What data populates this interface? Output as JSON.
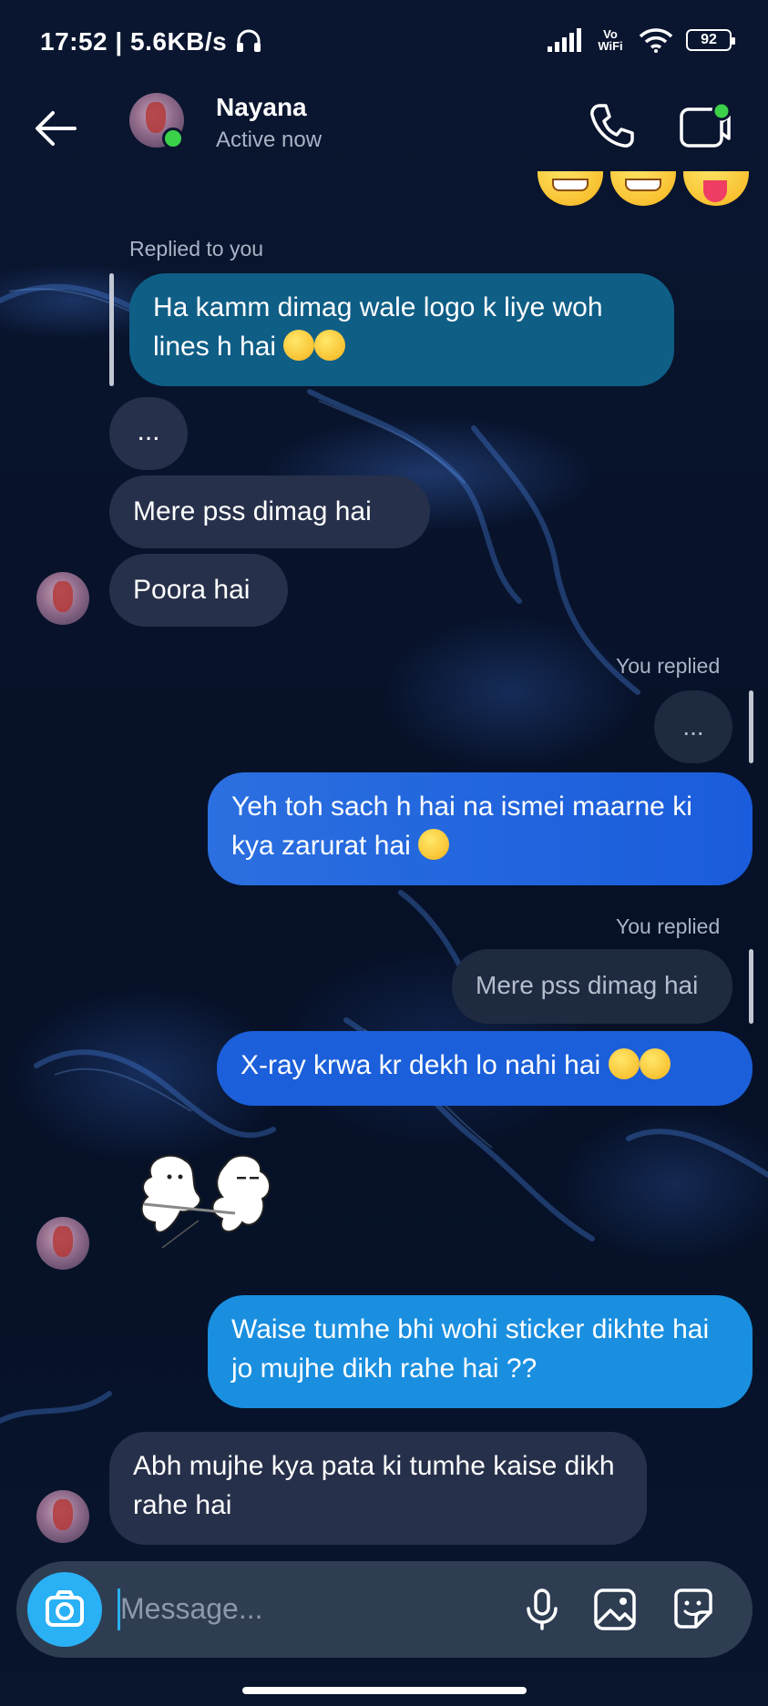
{
  "status_bar": {
    "time": "17:52",
    "speed": "| 5.6KB/s",
    "vowifi": "Vo WiFi",
    "battery": "92",
    "icons": [
      "headphones-icon",
      "signal-icon",
      "wifi-icon",
      "battery-icon"
    ]
  },
  "header": {
    "name": "Nayana",
    "status": "Active now",
    "icons": [
      "back-arrow-icon",
      "phone-icon",
      "video-icon"
    ],
    "colors": {
      "online": "#3bd24a"
    }
  },
  "messages": {
    "replied_to_you": "Replied to you",
    "quoted_1": "Ha kamm dimag wale logo k liye woh lines h hai",
    "in_dots": "...",
    "in_1": "Mere pss dimag hai",
    "in_2": "Poora hai",
    "you_replied_1": "You replied",
    "ghost_dots": "...",
    "out_1": "Yeh toh sach h hai na ismei maarne ki kya zarurat hai",
    "you_replied_2": "You replied",
    "ghost_2": "Mere pss dimag hai",
    "out_2": "X-ray krwa kr dekh lo nahi hai",
    "out_3": "Waise tumhe bhi wohi sticker dikhte hai jo mujhe dikh rahe hai ??",
    "in_3": "Abh mujhe kya pata ki tumhe kaise dikh rahe hai"
  },
  "composer": {
    "placeholder": "Message...",
    "icons": [
      "camera-icon",
      "microphone-icon",
      "gallery-icon",
      "sticker-icon"
    ],
    "colors": {
      "accent": "#2ab0f5"
    }
  }
}
